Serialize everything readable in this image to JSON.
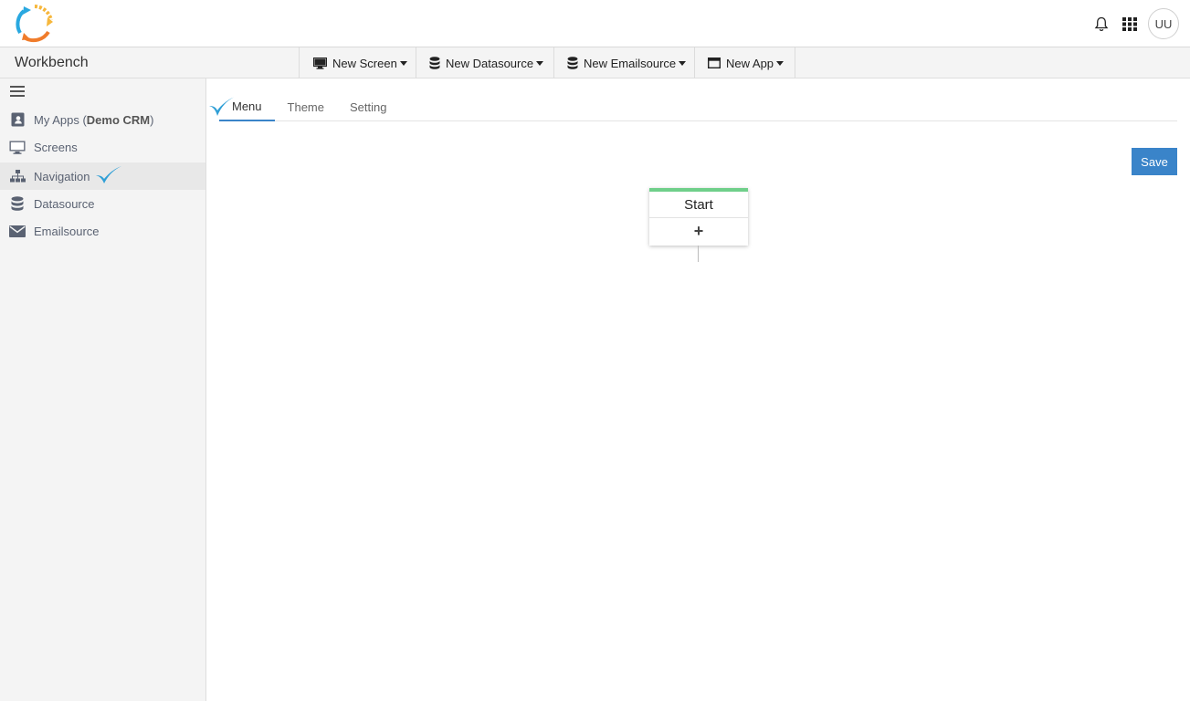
{
  "header": {
    "logo_icon": "circular-arrows-logo",
    "notification_icon": "bell-icon",
    "apps_icon": "grid-icon",
    "avatar_initials": "UU"
  },
  "workbench": {
    "title": "Workbench",
    "toolbar": [
      {
        "label": "New Screen",
        "icon": "monitor-icon"
      },
      {
        "label": "New Datasource",
        "icon": "database-icon"
      },
      {
        "label": "New Emailsource",
        "icon": "database-icon"
      },
      {
        "label": "New App",
        "icon": "window-icon"
      }
    ]
  },
  "sidebar": {
    "menu_icon": "hamburger-icon",
    "items": [
      {
        "prefix": "My Apps (",
        "bold": "Demo CRM",
        "suffix": ")",
        "icon": "contact-book-icon"
      },
      {
        "label": "Screens",
        "icon": "monitor-icon"
      },
      {
        "label": "Navigation",
        "icon": "sitemap-icon",
        "active": true
      },
      {
        "label": "Datasource",
        "icon": "database-icon"
      },
      {
        "label": "Emailsource",
        "icon": "envelope-icon"
      }
    ]
  },
  "tabs": [
    {
      "label": "Menu",
      "active": true
    },
    {
      "label": "Theme"
    },
    {
      "label": "Setting"
    }
  ],
  "actions": {
    "save_label": "Save"
  },
  "flow": {
    "start_node_label": "Start",
    "add_symbol": "+"
  },
  "colors": {
    "accent": "#3a84c9",
    "node_top": "#6fcf8a",
    "checkmark": "#2f9fd6"
  }
}
